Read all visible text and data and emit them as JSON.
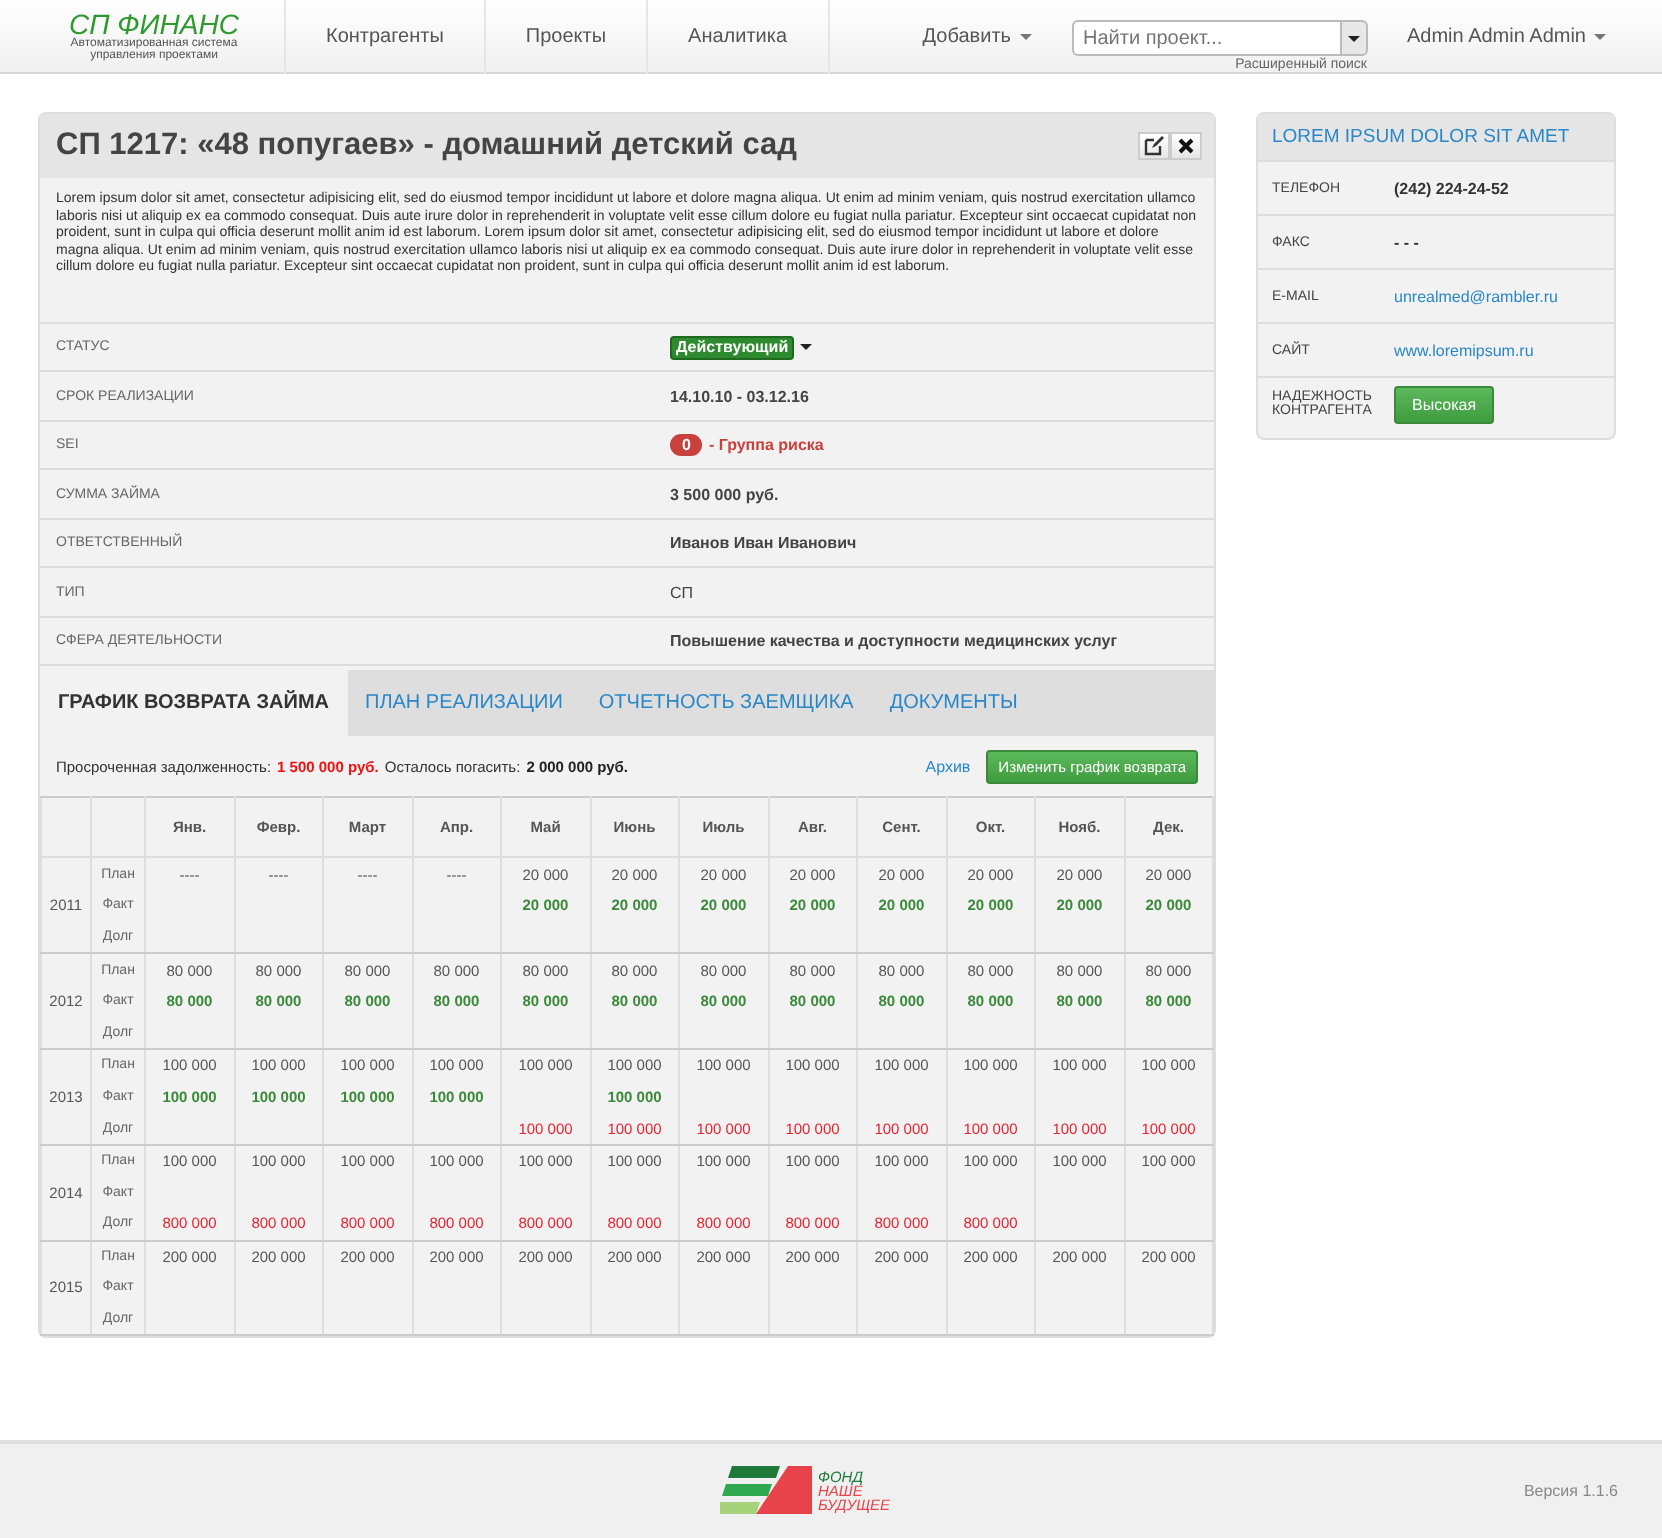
{
  "navbar": {
    "brand": "СП ФИНАНС",
    "brand_subtitle": "Автоматизированная система управления проектами",
    "items": [
      {
        "label": "Контрагенты"
      },
      {
        "label": "Проекты"
      },
      {
        "label": "Аналитика"
      }
    ],
    "add_menu": "Добавить",
    "search": {
      "placeholder": "Найти проект...",
      "advanced_link": "Расширенный поиск"
    },
    "user_menu": "Admin Admin Admin"
  },
  "project": {
    "title": "СП 1217: «48 попугаев» - домашний детский сад",
    "description": "Lorem ipsum dolor sit amet, consectetur adipisicing elit, sed do eiusmod tempor incididunt ut labore et dolore magna aliqua. Ut enim ad minim veniam, quis nostrud exercitation ullamco laboris nisi ut aliquip ex ea commodo consequat. Duis aute irure dolor in reprehenderit in voluptate velit esse cillum dolore eu fugiat nulla pariatur. Excepteur sint occaecat cupidatat non proident, sunt in culpa qui officia deserunt mollit anim id est laborum. Lorem ipsum dolor sit amet, consectetur adipisicing elit, sed do eiusmod tempor incididunt ut labore et dolore magna aliqua. Ut enim ad minim veniam, quis nostrud exercitation ullamco laboris nisi ut aliquip ex ea commodo consequat. Duis aute irure dolor in reprehenderit in voluptate velit esse cillum dolore eu fugiat nulla pariatur. Excepteur sint occaecat cupidatat non proident, sunt in culpa qui officia deserunt mollit anim id est laborum.",
    "fields": [
      {
        "label": "СТАТУС",
        "kind": "status",
        "value": "Действующий"
      },
      {
        "label": "СРОК РЕАЛИЗАЦИИ",
        "kind": "bold",
        "value": "14.10.10 - 03.12.16"
      },
      {
        "label": "SEI",
        "kind": "risk",
        "badge": "0",
        "value": "- Группа риска"
      },
      {
        "label": "СУММА ЗАЙМА",
        "kind": "bold",
        "value": "3 500 000 руб."
      },
      {
        "label": "ОТВЕТСТВЕННЫЙ",
        "kind": "bold",
        "value": "Иванов Иван Иванович"
      },
      {
        "label": "ТИП",
        "kind": "plain",
        "value": "СП"
      },
      {
        "label": "СФЕРА ДЕЯТЕЛЬНОСТИ",
        "kind": "bold",
        "value": "Повышение качества и доступности медицинских услуг"
      }
    ],
    "tabs": [
      {
        "label": "ГРАФИК ВОЗВРАТА ЗАЙМА",
        "selected": true
      },
      {
        "label": "ПЛАН РЕАЛИЗАЦИИ",
        "selected": false
      },
      {
        "label": "ОТЧЕТНОСТЬ ЗАЕМЩИКА",
        "selected": false
      },
      {
        "label": "ДОКУМЕНТЫ",
        "selected": false
      }
    ],
    "summary": [
      {
        "kind": "overdue",
        "label": "Просроченная задолженность:",
        "value": "1 500 000 руб."
      },
      {
        "kind": "remaining",
        "label": "Осталось погасить:",
        "value": "2 000 000 руб."
      }
    ],
    "archive_link": "Архив",
    "change_button": "Изменить график возврата",
    "schedule": {
      "months": [
        "Янв.",
        "Февр.",
        "Март",
        "Апр.",
        "Май",
        "Июнь",
        "Июль",
        "Авг.",
        "Сент.",
        "Окт.",
        "Нояб.",
        "Дек."
      ],
      "years": [
        {
          "year": "2011",
          "lines": [
            {
              "kind": "plan",
              "label": "План",
              "cells": [
                {
                  "kind": "amount",
                  "value": "----"
                },
                {
                  "kind": "amount",
                  "value": "----"
                },
                {
                  "kind": "amount",
                  "value": "----"
                },
                {
                  "kind": "amount",
                  "value": "----"
                },
                {
                  "kind": "amount",
                  "value": "20 000"
                },
                {
                  "kind": "amount",
                  "value": "20 000"
                },
                {
                  "kind": "amount",
                  "value": "20 000"
                },
                {
                  "kind": "amount",
                  "value": "20 000"
                },
                {
                  "kind": "amount",
                  "value": "20 000"
                },
                {
                  "kind": "amount",
                  "value": "20 000"
                },
                {
                  "kind": "amount",
                  "value": "20 000"
                },
                {
                  "kind": "amount",
                  "value": "20 000"
                }
              ]
            },
            {
              "kind": "fact",
              "label": "Факт",
              "cells": [
                {
                  "kind": "empty"
                },
                {
                  "kind": "empty"
                },
                {
                  "kind": "empty"
                },
                {
                  "kind": "empty"
                },
                {
                  "kind": "amount",
                  "value": "20 000"
                },
                {
                  "kind": "amount",
                  "value": "20 000"
                },
                {
                  "kind": "amount",
                  "value": "20 000"
                },
                {
                  "kind": "amount",
                  "value": "20 000"
                },
                {
                  "kind": "amount",
                  "value": "20 000"
                },
                {
                  "kind": "amount",
                  "value": "20 000"
                },
                {
                  "kind": "amount",
                  "value": "20 000"
                },
                {
                  "kind": "amount",
                  "value": "20 000"
                }
              ]
            },
            {
              "kind": "debt",
              "label": "Долг",
              "cells": [
                {
                  "kind": "empty"
                },
                {
                  "kind": "empty"
                },
                {
                  "kind": "empty"
                },
                {
                  "kind": "empty"
                },
                {
                  "kind": "empty"
                },
                {
                  "kind": "empty"
                },
                {
                  "kind": "empty"
                },
                {
                  "kind": "empty"
                },
                {
                  "kind": "empty"
                },
                {
                  "kind": "empty"
                },
                {
                  "kind": "empty"
                },
                {
                  "kind": "empty"
                }
              ]
            }
          ]
        },
        {
          "year": "2012",
          "lines": [
            {
              "kind": "plan",
              "label": "План",
              "cells": [
                {
                  "kind": "amount",
                  "value": "80 000"
                },
                {
                  "kind": "amount",
                  "value": "80 000"
                },
                {
                  "kind": "amount",
                  "value": "80 000"
                },
                {
                  "kind": "amount",
                  "value": "80 000"
                },
                {
                  "kind": "amount",
                  "value": "80 000"
                },
                {
                  "kind": "amount",
                  "value": "80 000"
                },
                {
                  "kind": "amount",
                  "value": "80 000"
                },
                {
                  "kind": "amount",
                  "value": "80 000"
                },
                {
                  "kind": "amount",
                  "value": "80 000"
                },
                {
                  "kind": "amount",
                  "value": "80 000"
                },
                {
                  "kind": "amount",
                  "value": "80 000"
                },
                {
                  "kind": "amount",
                  "value": "80 000"
                }
              ]
            },
            {
              "kind": "fact",
              "label": "Факт",
              "cells": [
                {
                  "kind": "amount",
                  "value": "80 000"
                },
                {
                  "kind": "amount",
                  "value": "80 000"
                },
                {
                  "kind": "amount",
                  "value": "80 000"
                },
                {
                  "kind": "amount",
                  "value": "80 000"
                },
                {
                  "kind": "amount",
                  "value": "80 000"
                },
                {
                  "kind": "amount",
                  "value": "80 000"
                },
                {
                  "kind": "amount",
                  "value": "80 000"
                },
                {
                  "kind": "amount",
                  "value": "80 000"
                },
                {
                  "kind": "amount",
                  "value": "80 000"
                },
                {
                  "kind": "amount",
                  "value": "80 000"
                },
                {
                  "kind": "amount",
                  "value": "80 000"
                },
                {
                  "kind": "amount",
                  "value": "80 000"
                }
              ]
            },
            {
              "kind": "debt",
              "label": "Долг",
              "cells": [
                {
                  "kind": "empty"
                },
                {
                  "kind": "empty"
                },
                {
                  "kind": "empty"
                },
                {
                  "kind": "empty"
                },
                {
                  "kind": "empty"
                },
                {
                  "kind": "empty"
                },
                {
                  "kind": "empty"
                },
                {
                  "kind": "empty"
                },
                {
                  "kind": "empty"
                },
                {
                  "kind": "empty"
                },
                {
                  "kind": "empty"
                },
                {
                  "kind": "empty"
                }
              ]
            }
          ]
        },
        {
          "year": "2013",
          "lines": [
            {
              "kind": "plan",
              "label": "План",
              "cells": [
                {
                  "kind": "amount",
                  "value": "100 000"
                },
                {
                  "kind": "amount",
                  "value": "100 000"
                },
                {
                  "kind": "amount",
                  "value": "100 000"
                },
                {
                  "kind": "amount",
                  "value": "100 000"
                },
                {
                  "kind": "amount",
                  "value": "100 000"
                },
                {
                  "kind": "amount",
                  "value": "100 000"
                },
                {
                  "kind": "amount",
                  "value": "100 000"
                },
                {
                  "kind": "amount",
                  "value": "100 000"
                },
                {
                  "kind": "amount",
                  "value": "100 000"
                },
                {
                  "kind": "amount",
                  "value": "100 000"
                },
                {
                  "kind": "amount",
                  "value": "100 000"
                },
                {
                  "kind": "amount",
                  "value": "100 000"
                }
              ]
            },
            {
              "kind": "fact",
              "label": "Факт",
              "cells": [
                {
                  "kind": "amount",
                  "value": "100 000"
                },
                {
                  "kind": "amount",
                  "value": "100 000"
                },
                {
                  "kind": "amount",
                  "value": "100 000"
                },
                {
                  "kind": "amount",
                  "value": "100 000"
                },
                {
                  "kind": "empty"
                },
                {
                  "kind": "amount",
                  "value": "100 000"
                },
                {
                  "kind": "empty"
                },
                {
                  "kind": "empty"
                },
                {
                  "kind": "empty"
                },
                {
                  "kind": "empty"
                },
                {
                  "kind": "empty"
                },
                {
                  "kind": "empty"
                }
              ]
            },
            {
              "kind": "debt",
              "label": "Долг",
              "cells": [
                {
                  "kind": "empty"
                },
                {
                  "kind": "empty"
                },
                {
                  "kind": "empty"
                },
                {
                  "kind": "empty"
                },
                {
                  "kind": "amount",
                  "value": "100 000"
                },
                {
                  "kind": "amount",
                  "value": "100 000"
                },
                {
                  "kind": "amount",
                  "value": "100 000"
                },
                {
                  "kind": "amount",
                  "value": "100 000"
                },
                {
                  "kind": "amount",
                  "value": "100 000"
                },
                {
                  "kind": "amount",
                  "value": "100 000"
                },
                {
                  "kind": "amount",
                  "value": "100 000"
                },
                {
                  "kind": "amount",
                  "value": "100 000"
                }
              ]
            }
          ]
        },
        {
          "year": "2014",
          "lines": [
            {
              "kind": "plan",
              "label": "План",
              "cells": [
                {
                  "kind": "amount",
                  "value": "100 000"
                },
                {
                  "kind": "amount",
                  "value": "100 000"
                },
                {
                  "kind": "amount",
                  "value": "100 000"
                },
                {
                  "kind": "amount",
                  "value": "100 000"
                },
                {
                  "kind": "amount",
                  "value": "100 000"
                },
                {
                  "kind": "amount",
                  "value": "100 000"
                },
                {
                  "kind": "amount",
                  "value": "100 000"
                },
                {
                  "kind": "amount",
                  "value": "100 000"
                },
                {
                  "kind": "amount",
                  "value": "100 000"
                },
                {
                  "kind": "amount",
                  "value": "100 000"
                },
                {
                  "kind": "amount",
                  "value": "100 000"
                },
                {
                  "kind": "amount",
                  "value": "100 000"
                }
              ]
            },
            {
              "kind": "fact",
              "label": "Факт",
              "cells": [
                {
                  "kind": "empty"
                },
                {
                  "kind": "empty"
                },
                {
                  "kind": "empty"
                },
                {
                  "kind": "empty"
                },
                {
                  "kind": "empty"
                },
                {
                  "kind": "empty"
                },
                {
                  "kind": "empty"
                },
                {
                  "kind": "empty"
                },
                {
                  "kind": "empty"
                },
                {
                  "kind": "empty"
                },
                {
                  "kind": "empty"
                },
                {
                  "kind": "empty"
                }
              ]
            },
            {
              "kind": "debt",
              "label": "Долг",
              "cells": [
                {
                  "kind": "amount",
                  "value": "800 000"
                },
                {
                  "kind": "amount",
                  "value": "800 000"
                },
                {
                  "kind": "amount",
                  "value": "800 000"
                },
                {
                  "kind": "amount",
                  "value": "800 000"
                },
                {
                  "kind": "amount",
                  "value": "800 000"
                },
                {
                  "kind": "amount",
                  "value": "800 000"
                },
                {
                  "kind": "amount",
                  "value": "800 000"
                },
                {
                  "kind": "amount",
                  "value": "800 000"
                },
                {
                  "kind": "amount",
                  "value": "800 000"
                },
                {
                  "kind": "amount",
                  "value": "800 000"
                },
                {
                  "kind": "empty"
                },
                {
                  "kind": "empty"
                }
              ]
            }
          ]
        },
        {
          "year": "2015",
          "lines": [
            {
              "kind": "plan",
              "label": "План",
              "cells": [
                {
                  "kind": "amount",
                  "value": "200 000"
                },
                {
                  "kind": "amount",
                  "value": "200 000"
                },
                {
                  "kind": "amount",
                  "value": "200 000"
                },
                {
                  "kind": "amount",
                  "value": "200 000"
                },
                {
                  "kind": "amount",
                  "value": "200 000"
                },
                {
                  "kind": "amount",
                  "value": "200 000"
                },
                {
                  "kind": "amount",
                  "value": "200 000"
                },
                {
                  "kind": "amount",
                  "value": "200 000"
                },
                {
                  "kind": "amount",
                  "value": "200 000"
                },
                {
                  "kind": "amount",
                  "value": "200 000"
                },
                {
                  "kind": "amount",
                  "value": "200 000"
                },
                {
                  "kind": "amount",
                  "value": "200 000"
                }
              ]
            },
            {
              "kind": "fact",
              "label": "Факт",
              "cells": [
                {
                  "kind": "empty"
                },
                {
                  "kind": "empty"
                },
                {
                  "kind": "empty"
                },
                {
                  "kind": "empty"
                },
                {
                  "kind": "empty"
                },
                {
                  "kind": "empty"
                },
                {
                  "kind": "empty"
                },
                {
                  "kind": "empty"
                },
                {
                  "kind": "empty"
                },
                {
                  "kind": "empty"
                },
                {
                  "kind": "empty"
                },
                {
                  "kind": "empty"
                }
              ]
            },
            {
              "kind": "debt",
              "label": "Долг",
              "cells": [
                {
                  "kind": "empty"
                },
                {
                  "kind": "empty"
                },
                {
                  "kind": "empty"
                },
                {
                  "kind": "empty"
                },
                {
                  "kind": "empty"
                },
                {
                  "kind": "empty"
                },
                {
                  "kind": "empty"
                },
                {
                  "kind": "empty"
                },
                {
                  "kind": "empty"
                },
                {
                  "kind": "empty"
                },
                {
                  "kind": "empty"
                },
                {
                  "kind": "empty"
                }
              ]
            }
          ]
        }
      ]
    }
  },
  "contractor": {
    "title": "LOREM IPSUM DOLOR SIT AMET",
    "rows": [
      {
        "label": "ТЕЛЕФОН",
        "kind": "text",
        "value": "(242) 224-24-52"
      },
      {
        "label": "ФАКС",
        "kind": "text",
        "value": "- - -"
      },
      {
        "label": "E-MAIL",
        "kind": "link",
        "value": "unrealmed@rambler.ru"
      },
      {
        "label": "САЙТ",
        "kind": "link",
        "value": "www.loremipsum.ru"
      },
      {
        "label": "НАДЕЖНОСТЬ КОНТРАГЕНТА",
        "kind": "button",
        "value": "Высокая"
      }
    ]
  },
  "footer": {
    "logo_lines": [
      "ФОНД",
      "НАШЕ",
      "БУДУЩЕЕ"
    ],
    "version": "Версия 1.1.6"
  }
}
